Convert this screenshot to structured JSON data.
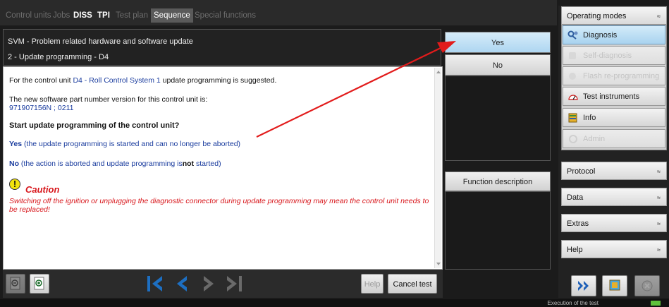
{
  "tabs": [
    {
      "label": "Control units"
    },
    {
      "label": "Jobs"
    },
    {
      "label": "DISS"
    },
    {
      "label": "TPI"
    },
    {
      "label": "Test plan"
    },
    {
      "label": "Sequence"
    },
    {
      "label": "Special functions"
    }
  ],
  "header": {
    "title": "SVM - Problem related hardware and software update",
    "step": "2 - Update programming - D4"
  },
  "content": {
    "line1_prefix": "For the control unit",
    "line1_unit": "D4 - Roll Control System 1",
    "line1_suffix": "update programming is suggested.",
    "line2": "The new software part number version for this control unit is:",
    "part_number": "971907156N ; 0211",
    "question": "Start update programming of the control unit?",
    "yes_word": "Yes",
    "yes_text": "(the update programming is started and can no longer be aborted)",
    "no_word": "No",
    "no_text_a": "(the action is aborted and update programming is",
    "no_text_not": "not",
    "no_text_b": "started)",
    "caution_icon_symbol": "!",
    "caution_title": "Caution",
    "caution_text": "Switching off the ignition or unplugging the diagnostic connector during update programming may mean the control unit needs to be replaced!"
  },
  "answers": {
    "yes": "Yes",
    "no": "No",
    "function_description": "Function description"
  },
  "toolbar": {
    "help": "Help",
    "cancel": "Cancel test"
  },
  "sidebar": {
    "operating_modes": "Operating modes",
    "modes": [
      {
        "label": "Diagnosis",
        "icon": "stethoscope-icon"
      },
      {
        "label": "Self-diagnosis",
        "icon": "self-diagnosis-icon"
      },
      {
        "label": "Flash re-programming",
        "icon": "flash-icon"
      },
      {
        "label": "Test instruments",
        "icon": "gauge-icon"
      },
      {
        "label": "Info",
        "icon": "book-icon"
      },
      {
        "label": "Admin",
        "icon": "admin-icon"
      }
    ],
    "sections": [
      {
        "label": "Protocol"
      },
      {
        "label": "Data"
      },
      {
        "label": "Extras"
      },
      {
        "label": "Help"
      }
    ],
    "chevron_up": "≈",
    "chevron_down": "≈"
  },
  "status": {
    "text": "Execution of the test"
  },
  "colors": {
    "accent_blue": "#1a3c9e",
    "caution_red": "#d8161b",
    "annotation_arrow": "#e21b1b"
  }
}
